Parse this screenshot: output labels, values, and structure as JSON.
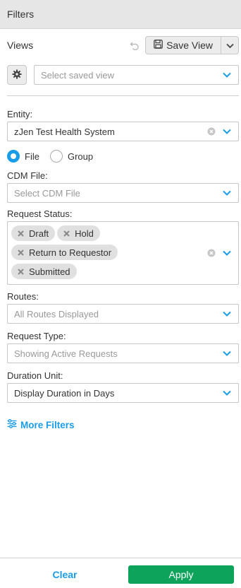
{
  "panel": {
    "title": "Filters"
  },
  "views": {
    "label": "Views",
    "save_label": "Save View",
    "select_placeholder": "Select saved view"
  },
  "entity": {
    "label": "Entity:",
    "value": "zJen Test Health System"
  },
  "radio": {
    "file_label": "File",
    "group_label": "Group",
    "selected": "File"
  },
  "cdm_file": {
    "label": "CDM File:",
    "placeholder": "Select CDM File"
  },
  "request_status": {
    "label": "Request Status:",
    "chips": [
      "Draft",
      "Hold",
      "Return to Requestor",
      "Submitted"
    ]
  },
  "routes": {
    "label": "Routes:",
    "value": "All Routes Displayed"
  },
  "request_type": {
    "label": "Request Type:",
    "value": "Showing Active Requests"
  },
  "duration_unit": {
    "label": "Duration Unit:",
    "value": "Display Duration in Days"
  },
  "more_filters": {
    "label": "More Filters"
  },
  "footer": {
    "clear_label": "Clear",
    "apply_label": "Apply"
  },
  "colors": {
    "accent": "#1a9de8",
    "apply": "#0ea35a",
    "header_bg": "#e6e6e6"
  }
}
